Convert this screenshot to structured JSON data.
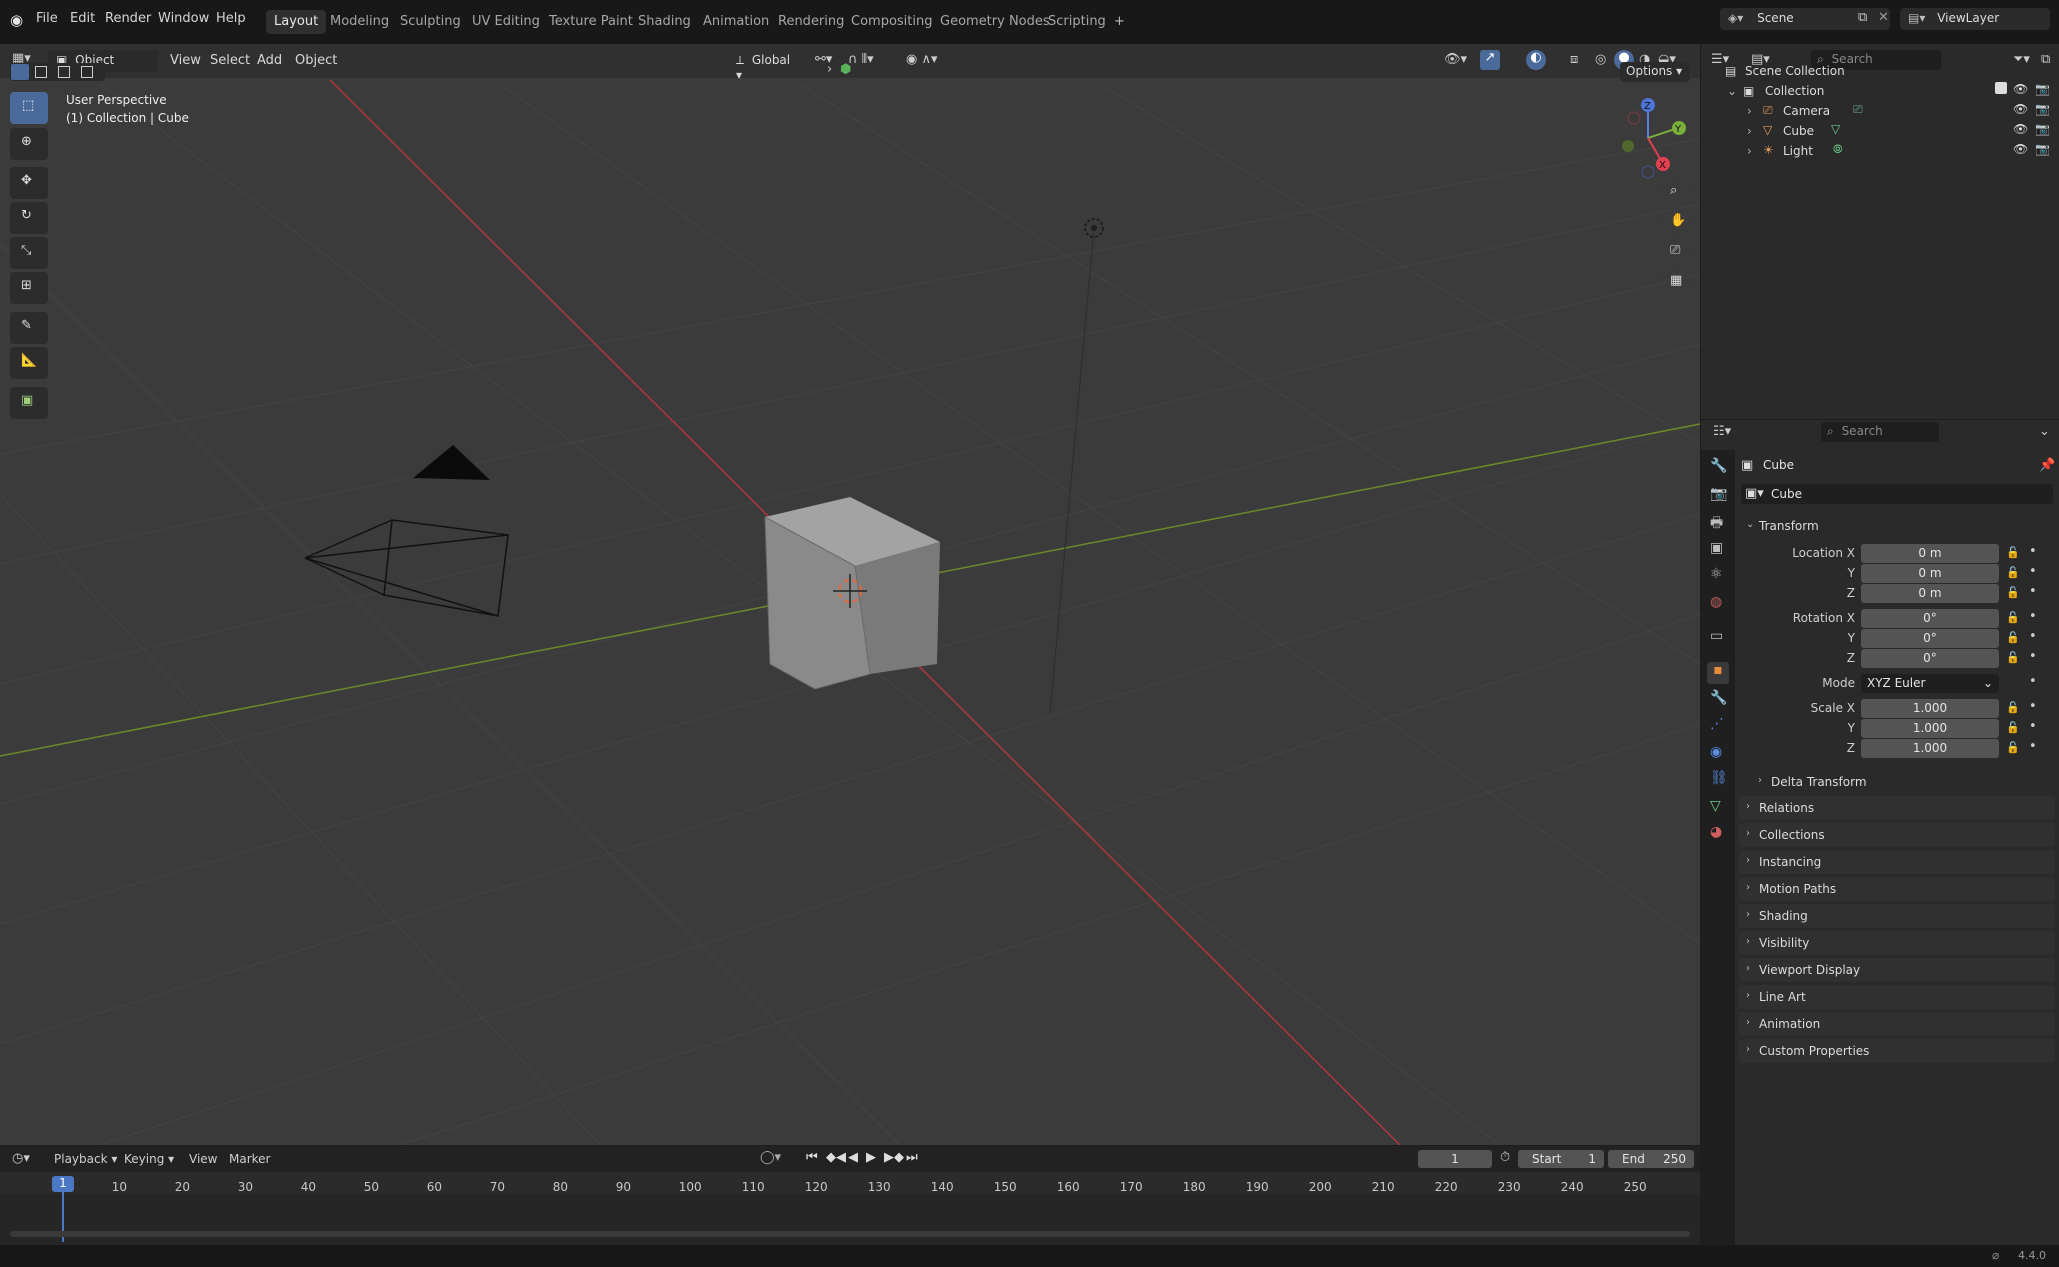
{
  "topbar": {
    "menus": [
      "File",
      "Edit",
      "Render",
      "Window",
      "Help"
    ],
    "workspaces": [
      "Layout",
      "Modeling",
      "Sculpting",
      "UV Editing",
      "Texture Paint",
      "Shading",
      "Animation",
      "Rendering",
      "Compositing",
      "Geometry Nodes",
      "Scripting"
    ],
    "add_tab": "+",
    "scene_label": "Scene",
    "viewlayer_label": "ViewLayer"
  },
  "viewport": {
    "mode": "Object Mode",
    "menus": [
      "View",
      "Select",
      "Add",
      "Object"
    ],
    "transform_orientation": "Global",
    "options_label": "Options",
    "overlay_title": "User Perspective",
    "overlay_subtitle": "(1) Collection | Cube",
    "gizmo_axes": {
      "z": "Z",
      "y": "Y",
      "x": "X"
    }
  },
  "outliner": {
    "search_placeholder": "Search",
    "scene_collection": "Scene Collection",
    "collection": "Collection",
    "items": [
      {
        "label": "Camera",
        "icon": "camera-icon"
      },
      {
        "label": "Cube",
        "icon": "mesh-icon"
      },
      {
        "label": "Light",
        "icon": "light-icon"
      }
    ]
  },
  "properties": {
    "search_placeholder": "Search",
    "object_name": "Cube",
    "datablock_name": "Cube",
    "transform_header": "Transform",
    "location_label": "Location X",
    "rotation_label": "Rotation X",
    "scale_label": "Scale X",
    "y_label": "Y",
    "z_label": "Z",
    "mode_label": "Mode",
    "location": [
      "0 m",
      "0 m",
      "0 m"
    ],
    "rotation": [
      "0°",
      "0°",
      "0°"
    ],
    "rotation_mode": "XYZ Euler",
    "scale": [
      "1.000",
      "1.000",
      "1.000"
    ],
    "delta_transform": "Delta Transform",
    "panels": [
      "Relations",
      "Collections",
      "Instancing",
      "Motion Paths",
      "Shading",
      "Visibility",
      "Viewport Display",
      "Line Art",
      "Animation",
      "Custom Properties"
    ]
  },
  "timeline": {
    "menus": [
      "Playback",
      "Keying",
      "View",
      "Marker"
    ],
    "current_frame": "1",
    "start_label": "Start",
    "start_value": "1",
    "end_label": "End",
    "end_value": "250",
    "ticks": [
      "10",
      "20",
      "30",
      "40",
      "50",
      "60",
      "70",
      "80",
      "90",
      "100",
      "110",
      "120",
      "130",
      "140",
      "150",
      "160",
      "170",
      "180",
      "190",
      "200",
      "210",
      "220",
      "230",
      "240",
      "250"
    ],
    "playhead_label": "1"
  },
  "statusbar": {
    "version": "4.4.0"
  }
}
